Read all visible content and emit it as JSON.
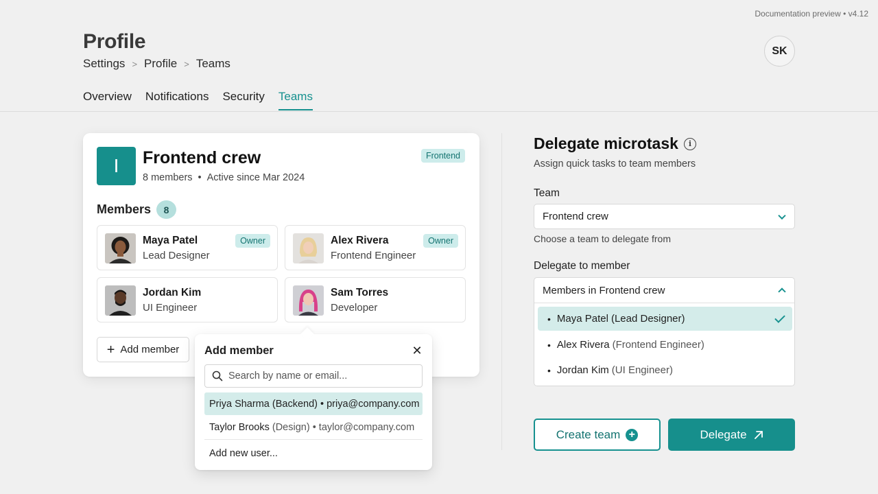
{
  "app": {
    "doc_preview": "Documentation preview • v4.12",
    "page_title": "Profile",
    "breadcrumb": [
      "Settings",
      "Profile",
      "Teams"
    ],
    "avatar_initials": "SK"
  },
  "tabs": [
    {
      "label": "Overview",
      "active": false
    },
    {
      "label": "Notifications",
      "active": false
    },
    {
      "label": "Security",
      "active": false
    },
    {
      "label": "Teams",
      "active": true
    }
  ],
  "team_card": {
    "logo_letter": "I",
    "name": "Frontend crew",
    "members_text": "8 members",
    "active_since": "Active since Mar 2024",
    "tag": "Frontend",
    "members_heading": "Members",
    "members_count": "8",
    "members": [
      {
        "name": "Maya Patel",
        "role": "Lead Designer",
        "badge": "Owner"
      },
      {
        "name": "Alex Rivera",
        "role": "Frontend Engineer",
        "badge": "Owner"
      },
      {
        "name": "Jordan Kim",
        "role": "UI Engineer",
        "badge": ""
      },
      {
        "name": "Sam Torres",
        "role": "Developer",
        "badge": ""
      }
    ],
    "add_member_label": "Add member"
  },
  "add_member_popover": {
    "title": "Add member",
    "search_placeholder": "Search by name or email...",
    "suggestions": [
      {
        "name": "Priya Sharma",
        "dept": "(Backend)",
        "email": "• priya@company.com",
        "selected": true
      },
      {
        "name": "Taylor Brooks",
        "dept": "(Design)",
        "email": "• taylor@company.com",
        "selected": false
      }
    ],
    "add_new_user": "Add new user..."
  },
  "delegate": {
    "title": "Delegate microtask",
    "subtitle": "Assign quick tasks to team members",
    "team_label": "Team",
    "team_value": "Frontend crew",
    "team_helper": "Choose a team to delegate from",
    "member_label": "Delegate to member",
    "member_dropdown_header": "Members in Frontend crew",
    "member_options": [
      {
        "name": "Maya Patel",
        "role": "(Lead Designer)",
        "selected": true
      },
      {
        "name": "Alex Rivera",
        "role": "(Frontend Engineer)",
        "selected": false
      },
      {
        "name": "Jordan Kim",
        "role": "(UI Engineer)",
        "selected": false
      }
    ],
    "create_team_label": "Create team",
    "delegate_label": "Delegate"
  },
  "colors": {
    "accent": "#16918f",
    "accent_light": "#d4ecea",
    "background": "#f0f0f0"
  }
}
